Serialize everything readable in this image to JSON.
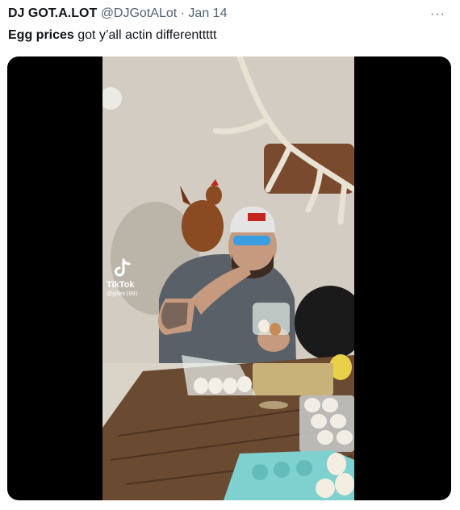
{
  "tweet": {
    "display_name": "DJ GOT.A.LOT",
    "handle": "@DJGotALot",
    "separator": "·",
    "date": "Jan 14",
    "more_label": "···",
    "text_bold": "Egg prices",
    "text_rest": " got y’all actin differenttttt"
  },
  "media": {
    "watermark_brand": "TikTok",
    "watermark_user": "@gillen1991",
    "icon": "tiktok-logo-icon"
  }
}
